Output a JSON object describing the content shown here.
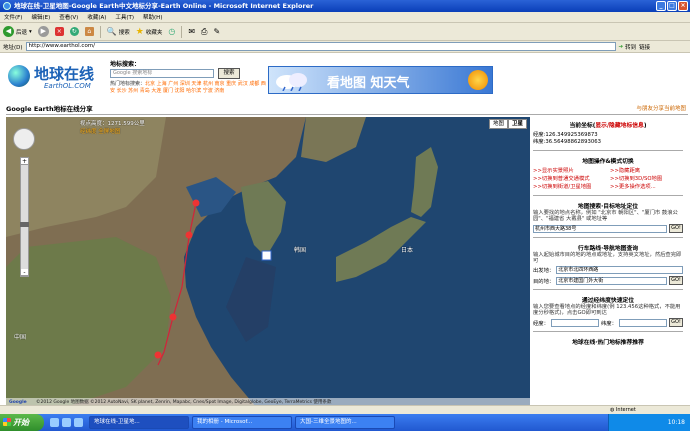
{
  "window": {
    "title": "地球在线-卫星地图-Google Earth中文地标分享-Earth Online - Microsoft Internet Explorer"
  },
  "menu": [
    "文件(F)",
    "编辑(E)",
    "查看(V)",
    "收藏(A)",
    "工具(T)",
    "帮助(H)"
  ],
  "toolbar": {
    "back": "后退",
    "search": "搜索",
    "favorites": "收藏夹"
  },
  "address": {
    "label": "地址(D)",
    "url": "http://www.earthol.com/",
    "go": "转到",
    "links": "链接"
  },
  "header": {
    "logo_cn": "地球在线",
    "logo_en": "EarthOL.COM",
    "search_label": "地标搜索：",
    "search_placeholder": "Google 搜索地标",
    "search_button": "搜索",
    "hot_label": "热门地标搜索：",
    "hot_items": "北京 上海 广州 深圳 天津 杭州 南京 重庆 武汉 成都 西安 长沙 苏州 青岛 大连 厦门 沈阳 哈尔滨 宁波 济南",
    "banner_text": "看地图 知天气"
  },
  "section": {
    "title": "Google Earth地标在线分享",
    "right_link": "与朋友分享当前地图"
  },
  "map": {
    "info_altitude": "视点高度：1271.599公里",
    "info_link": "经纬度 全屏地图",
    "type_map": "地图",
    "type_satellite": "卫星",
    "footer": "©2012 Google 地图数据 ©2012 AutoNavi, SK planet, Zenrin, Mapabc, Cnes/Spot Image, Digitalglobe, GeoEye, TerraMetrics 使用条款",
    "google": "Google",
    "labels": {
      "china": "中国",
      "korea": "韩国",
      "japan": "日本"
    }
  },
  "sidebar": {
    "coord_title": "当前坐标",
    "coord_link": "显示/隐藏地标信息",
    "lng": "经度:126.349925369873",
    "lat": "纬度:36.56498862893063",
    "ops_title": "地图操作&模式切换",
    "ops": [
      ">>显示实景照片",
      ">>隐藏距离",
      ">>切换到普通交通模式",
      ">>切换到3D/SO地图",
      ">>切换到街道/卫星地图",
      ">>更多操作选项..."
    ],
    "place_title": "地图搜索·目标地址定位",
    "place_desc": "输入要找的地点名称，例如 \"北京市 朝阳区\"、\"厦门市 鼓浪公园\"、\"福建省 大戴县\" 或地址等",
    "place_value": "杭州市西大路38号",
    "go": "GO!",
    "route_title": "行车路线·导航地图查询",
    "route_desc": "输入起始城市目的地的地点或地址，支持英文地址，然后查完即可",
    "from_label": "出发地：",
    "from_value": "北京市北四环西路",
    "to_label": "目的地：",
    "to_value": "北京市建国门外大街",
    "latlng_title": "通过经纬度快速定位",
    "latlng_desc": "输入您要查看地点的经度和纬度(例 123.456这种格式，不能用度分秒格式)，点击GO即可到达",
    "lng_label": "经度：",
    "lat_label": "纬度：",
    "bottom_title": "地球在线·热门地标推荐推荐"
  },
  "status": {
    "zone": "Internet"
  },
  "taskbar": {
    "start": "开始",
    "tasks": [
      "地球在线-卫星地...",
      "我的相册 - Microsof...",
      "大国-三维全景地图的..."
    ],
    "clock": "10:18"
  }
}
